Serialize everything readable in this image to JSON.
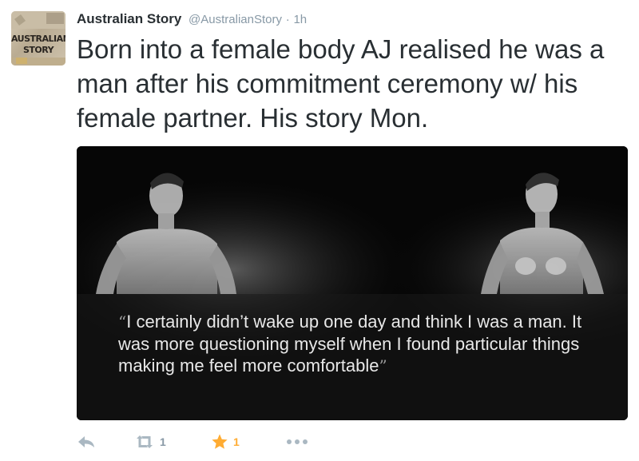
{
  "tweet": {
    "author_name": "Australian Story",
    "author_handle": "@AustralianStory",
    "separator": "·",
    "timestamp": "1h",
    "avatar_text_line1": "AUSTRALIAN",
    "avatar_text_line2": "STORY",
    "text": "Born into a female body AJ realised he was a man after his commitment ceremony w/ his female partner. His story Mon."
  },
  "media": {
    "quote_open": "“",
    "quote_text": "I certainly didn’t wake up one day and think I was a man. It was more questioning myself when I found particular things making me feel more comfortable",
    "quote_close": "”"
  },
  "actions": {
    "retweet_count": "1",
    "favorite_count": "1"
  },
  "icons": {
    "reply": "reply-icon",
    "retweet": "retweet-icon",
    "favorite": "star-icon",
    "more": "more-dots-icon"
  },
  "colors": {
    "text": "#292f33",
    "muted": "#8899a6",
    "favorite": "#ffac33",
    "icon": "#aab8c2"
  }
}
